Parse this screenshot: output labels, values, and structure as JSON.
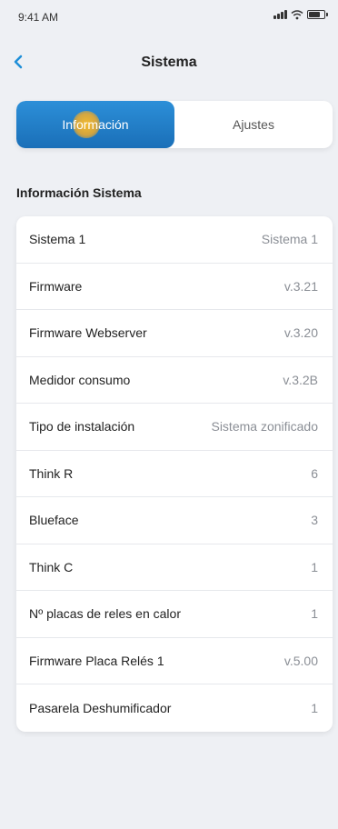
{
  "status": {
    "time": "9:41 AM"
  },
  "nav": {
    "title": "Sistema"
  },
  "tabs": [
    {
      "label": "Información",
      "active": true
    },
    {
      "label": "Ajustes",
      "active": false
    }
  ],
  "section": {
    "heading": "Información Sistema"
  },
  "rows": [
    {
      "label": "Sistema 1",
      "value": "Sistema 1"
    },
    {
      "label": "Firmware",
      "value": "v.3.21"
    },
    {
      "label": "Firmware Webserver",
      "value": "v.3.20"
    },
    {
      "label": "Medidor consumo",
      "value": "v.3.2B"
    },
    {
      "label": "Tipo de instalación",
      "value": "Sistema zonificado"
    },
    {
      "label": "Think R",
      "value": "6"
    },
    {
      "label": "Blueface",
      "value": "3"
    },
    {
      "label": "Think C",
      "value": "1"
    },
    {
      "label": "Nº placas de reles en calor",
      "value": "1"
    },
    {
      "label": "Firmware Placa Relés 1",
      "value": "v.5.00"
    },
    {
      "label": "Pasarela Deshumificador",
      "value": "1"
    }
  ],
  "colors": {
    "accent": "#1f7fc8",
    "back_arrow": "#1f8fd8",
    "background": "#eef0f4",
    "tap_indicator": "#ffb420"
  },
  "icons": {
    "back": "chevron-left-icon",
    "signal": "signal-icon",
    "wifi": "wifi-icon",
    "battery": "battery-icon"
  }
}
